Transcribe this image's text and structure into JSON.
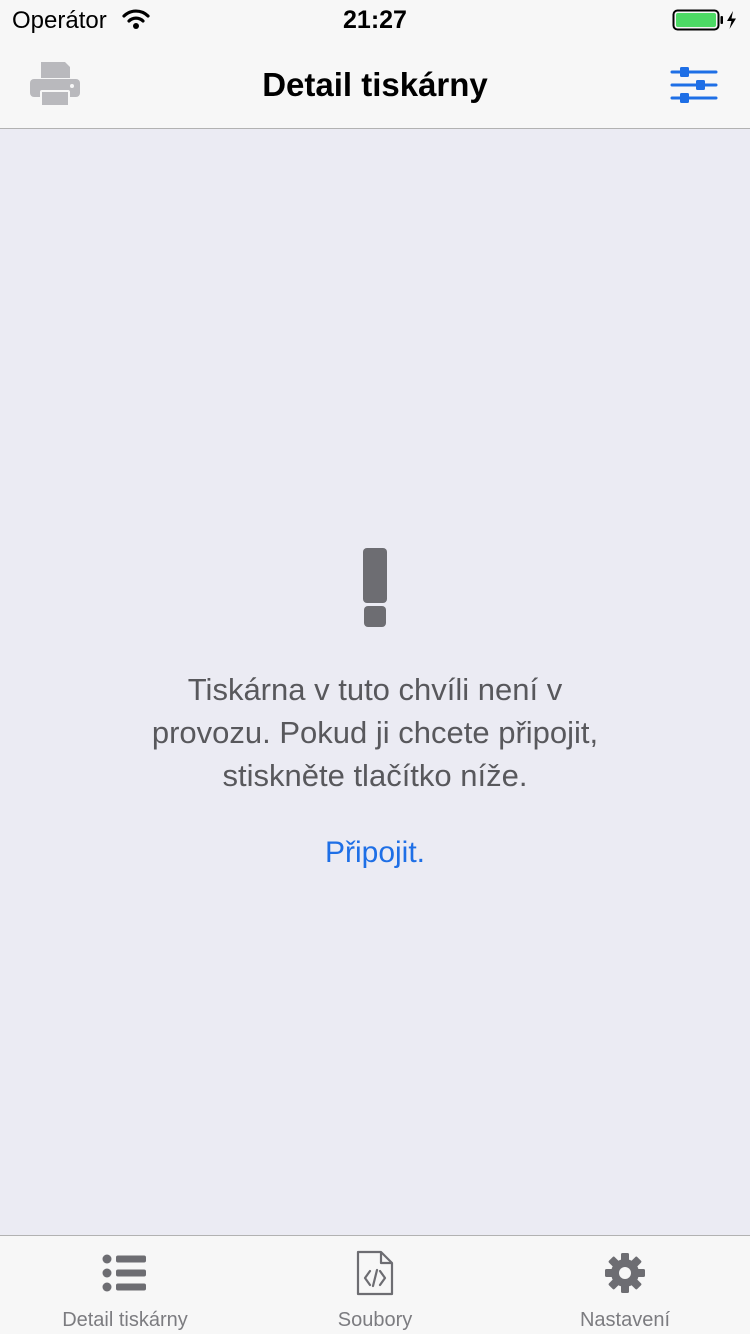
{
  "status_bar": {
    "carrier": "Operátor",
    "time": "21:27",
    "wifi_icon": "wifi-icon",
    "battery_icon": "battery-charging-icon"
  },
  "nav_bar": {
    "title": "Detail tiskárny",
    "left_icon": "printer-icon",
    "right_icon": "sliders-icon"
  },
  "content": {
    "icon": "exclamation-icon",
    "message_lines": [
      "Tiskárna v tuto chvíli není v",
      "provozu. Pokud ji chcete připojit,",
      "stiskněte tlačítko níže."
    ],
    "connect_label": "Připojit."
  },
  "tabs": [
    {
      "label": "Detail tiskárny",
      "icon": "list-icon"
    },
    {
      "label": "Soubory",
      "icon": "code-file-icon"
    },
    {
      "label": "Nastavení",
      "icon": "gear-icon"
    }
  ],
  "colors": {
    "accent": "#1e6fe6",
    "background": "#ebebf3",
    "bar_background": "#f7f7f7",
    "icon_gray": "#6d6d72",
    "battery_green": "#4cd964"
  }
}
